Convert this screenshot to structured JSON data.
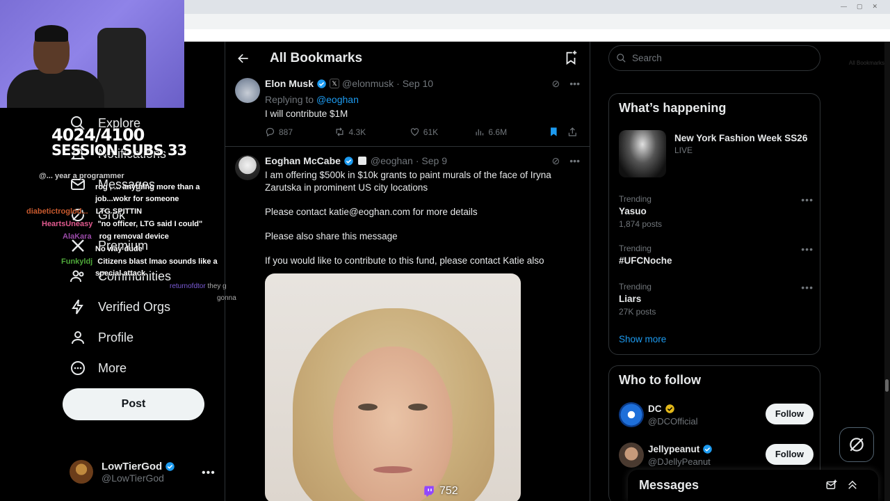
{
  "browser": {
    "bookmarks_label": "All Bookmarks"
  },
  "stream": {
    "counter_line1": "4024/4100",
    "counter_line2": "SESSION SUBS 33",
    "viewer_count": "752",
    "chat": [
      {
        "user": "",
        "text": "@...  year a programmer",
        "color": "#b06bd6"
      },
      {
        "user": "",
        "text": "rog , ...  anything more than a",
        "color": "#ffffff"
      },
      {
        "user": "",
        "text": "job...wokr for someone",
        "color": "#ffffff"
      },
      {
        "user": "diabetictroglod...",
        "text": "LTG SPITTIN",
        "color": "#c95a2e"
      },
      {
        "user": "HeartsUneasy",
        "text": "\"no officer, LTG said I could\"",
        "color": "#e05a8f"
      },
      {
        "user": "AlaKara",
        "text": "rog removal device",
        "color": "#9a4aa8"
      },
      {
        "user": "",
        "text": "No way dude",
        "color": "#3d55c9"
      },
      {
        "user": "Funkyldj",
        "text": "Citizens blast lmao sounds like a",
        "color": "#4fa83a"
      },
      {
        "user": "",
        "text": "special attack",
        "color": "#ffffff"
      },
      {
        "user": "returnofdtor",
        "text": "they g",
        "color": "#7a5ad6"
      },
      {
        "user": "",
        "text": "gonna",
        "color": "#aaaaaa"
      }
    ]
  },
  "sidebar": {
    "items": [
      {
        "label": "Explore",
        "icon": "search-icon"
      },
      {
        "label": "Notifications",
        "icon": "bell-icon"
      },
      {
        "label": "Messages",
        "icon": "mail-icon"
      },
      {
        "label": "Grok",
        "icon": "grok-icon"
      },
      {
        "label": "Premium",
        "icon": "x-icon"
      },
      {
        "label": "Communities",
        "icon": "people-icon"
      },
      {
        "label": "Verified Orgs",
        "icon": "lightning-icon"
      },
      {
        "label": "Profile",
        "icon": "person-icon"
      },
      {
        "label": "More",
        "icon": "more-circle-icon"
      }
    ],
    "post_label": "Post",
    "account": {
      "name": "LowTierGod",
      "handle": "@LowTierGod"
    }
  },
  "main": {
    "title": "All Bookmarks",
    "tweets": [
      {
        "name": "Elon Musk",
        "handle": "@elonmusk",
        "date": "· Sep 10",
        "reply_prefix": "Replying to",
        "reply_to": "@eoghan",
        "text": "I will contribute $1M",
        "replies": "887",
        "retweets": "4.3K",
        "likes": "61K",
        "views": "6.6M"
      },
      {
        "name": "Eoghan McCabe",
        "handle": "@eoghan",
        "date": "· Sep 9",
        "p1": "I am offering $500k in $10k grants to paint murals of the face of Iryna Zarutska in prominent US city locations",
        "p2": "Please contact katie@eoghan.com for more details",
        "p3": "Please also share this message",
        "p4": "If you would like to contribute to this fund, please contact Katie also"
      }
    ]
  },
  "right": {
    "search_placeholder": "Search",
    "whats_happening": "What’s happening",
    "featured": {
      "title": "New York Fashion Week SS26",
      "status": "LIVE"
    },
    "trends": [
      {
        "label": "Trending",
        "name": "Yasuo",
        "count": "1,874 posts"
      },
      {
        "label": "Trending",
        "name": "#UFCNoche",
        "count": ""
      },
      {
        "label": "Trending",
        "name": "Liars",
        "count": "27K posts"
      }
    ],
    "show_more": "Show more",
    "who_to_follow": "Who to follow",
    "follow_suggestions": [
      {
        "name": "DC",
        "handle": "@DCOfficial",
        "button": "Follow"
      },
      {
        "name": "Jellypeanut",
        "handle": "@DJellyPeanut",
        "button": "Follow"
      }
    ],
    "messages_label": "Messages"
  },
  "colors": {
    "accent": "#1d9bf0",
    "background": "#000000",
    "border": "#2f3336",
    "muted": "#71767b",
    "gold_check": "#e2b719"
  }
}
